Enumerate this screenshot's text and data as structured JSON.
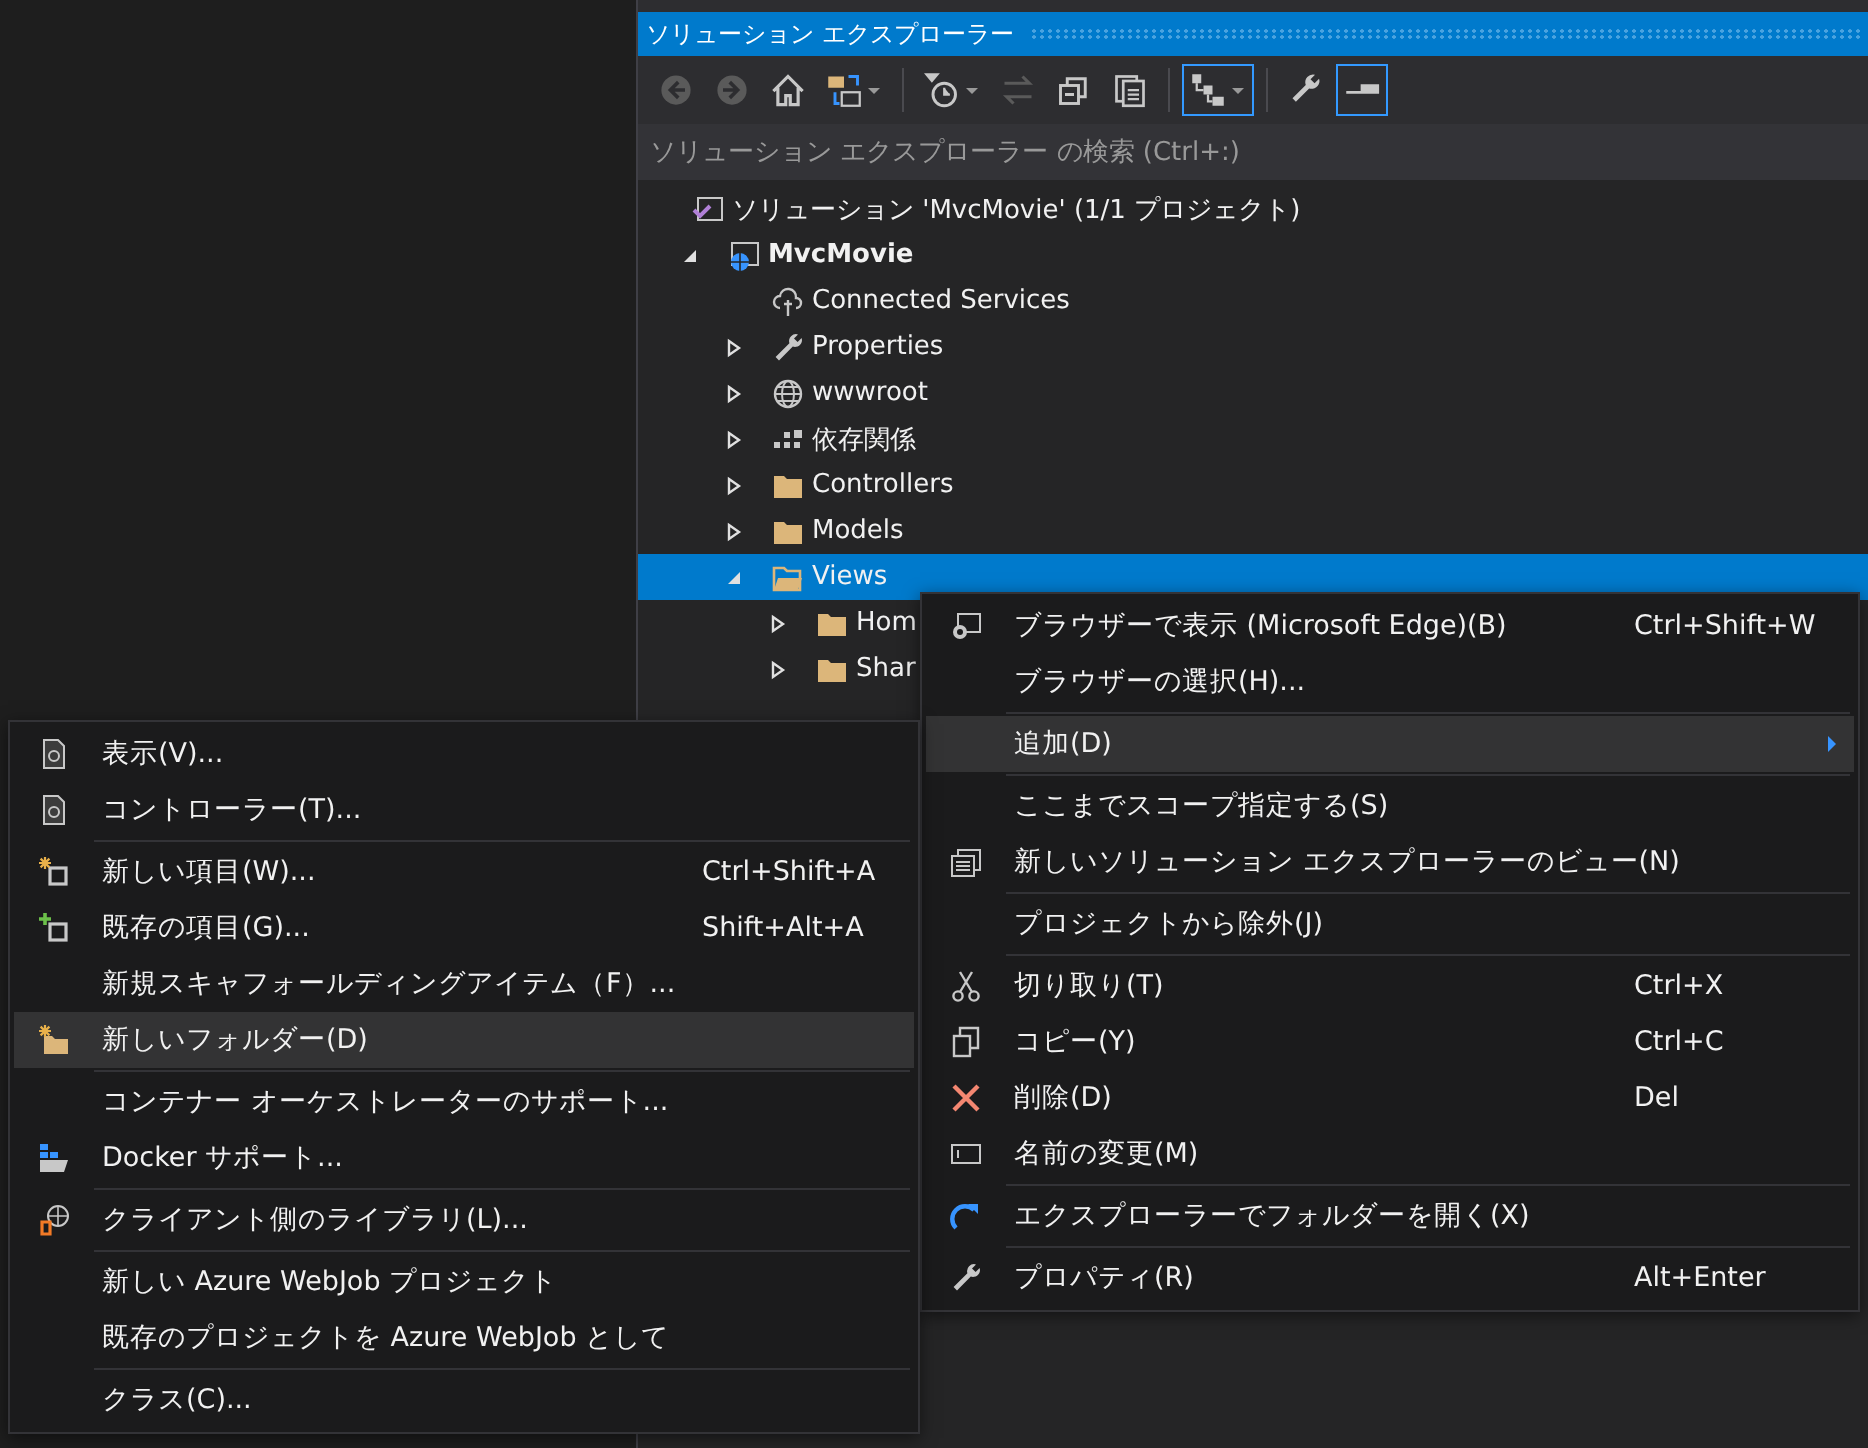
{
  "panel": {
    "title": "ソリューション エクスプローラー",
    "toolbar": [
      {
        "kind": "button",
        "selected": false,
        "disabled": true,
        "dropdown": false
      },
      {
        "kind": "button",
        "selected": false,
        "disabled": true,
        "dropdown": false
      },
      {
        "kind": "button",
        "selected": false,
        "disabled": false,
        "dropdown": false
      },
      {
        "kind": "button",
        "selected": false,
        "disabled": false,
        "dropdown": true
      },
      {
        "kind": "separator"
      },
      {
        "kind": "button",
        "selected": false,
        "disabled": false,
        "dropdown": true
      },
      {
        "kind": "button",
        "selected": false,
        "disabled": true,
        "dropdown": false
      },
      {
        "kind": "button",
        "selected": false,
        "disabled": false,
        "dropdown": false
      },
      {
        "kind": "button",
        "selected": false,
        "disabled": false,
        "dropdown": false
      },
      {
        "kind": "separator"
      },
      {
        "kind": "button",
        "selected": true,
        "disabled": false,
        "dropdown": true
      },
      {
        "kind": "separator"
      },
      {
        "kind": "button",
        "selected": false,
        "disabled": false,
        "dropdown": false
      },
      {
        "kind": "button",
        "selected": true,
        "disabled": false,
        "dropdown": false
      }
    ],
    "search": {
      "placeholder": "ソリューション エクスプローラー の検索 (Ctrl+:)"
    },
    "tree": [
      {
        "label": "ソリューション 'MvcMovie' (1/1 プロジェクト)",
        "kind": "solution",
        "selected": false,
        "children": [
          {
            "label": "MvcMovie",
            "kind": "project",
            "expanded": true,
            "selected": false,
            "children": [
              {
                "label": "Connected Services",
                "kind": "service",
                "selected": false
              },
              {
                "label": "Properties",
                "kind": "properties",
                "expanded": false,
                "selected": false
              },
              {
                "label": "wwwroot",
                "kind": "web",
                "expanded": false,
                "selected": false
              },
              {
                "label": "依存関係",
                "kind": "dependencies",
                "expanded": false,
                "selected": false
              },
              {
                "label": "Controllers",
                "kind": "folder",
                "expanded": false,
                "selected": false
              },
              {
                "label": "Models",
                "kind": "folder",
                "expanded": false,
                "selected": false
              },
              {
                "label": "Views",
                "kind": "folder",
                "expanded": true,
                "selected": true,
                "children": [
                  {
                    "label": "Hom",
                    "kind": "folder",
                    "expanded": false,
                    "selected": false
                  },
                  {
                    "label": "Shar",
                    "kind": "folder",
                    "expanded": false,
                    "selected": false
                  }
                ]
              }
            ]
          }
        ]
      }
    ]
  },
  "context_menu": [
    {
      "kind": "item",
      "label": "ブラウザーで表示 (Microsoft Edge)(B)",
      "shortcut": "Ctrl+Shift+W",
      "selected": false,
      "submenu": false
    },
    {
      "kind": "item",
      "label": "ブラウザーの選択(H)...",
      "selected": false,
      "submenu": false
    },
    {
      "kind": "separator"
    },
    {
      "kind": "item",
      "label": "追加(D)",
      "selected": true,
      "submenu": true
    },
    {
      "kind": "separator"
    },
    {
      "kind": "item",
      "label": "ここまでスコープ指定する(S)",
      "selected": false,
      "submenu": false
    },
    {
      "kind": "item",
      "label": "新しいソリューション エクスプローラーのビュー(N)",
      "selected": false,
      "submenu": false
    },
    {
      "kind": "separator"
    },
    {
      "kind": "item",
      "label": "プロジェクトから除外(J)",
      "selected": false,
      "submenu": false
    },
    {
      "kind": "separator"
    },
    {
      "kind": "item",
      "label": "切り取り(T)",
      "shortcut": "Ctrl+X",
      "selected": false,
      "submenu": false
    },
    {
      "kind": "item",
      "label": "コピー(Y)",
      "shortcut": "Ctrl+C",
      "selected": false,
      "submenu": false
    },
    {
      "kind": "item",
      "label": "削除(D)",
      "shortcut": "Del",
      "selected": false,
      "submenu": false
    },
    {
      "kind": "item",
      "label": "名前の変更(M)",
      "selected": false,
      "submenu": false
    },
    {
      "kind": "separator"
    },
    {
      "kind": "item",
      "label": "エクスプローラーでフォルダーを開く(X)",
      "selected": false,
      "submenu": false
    },
    {
      "kind": "separator"
    },
    {
      "kind": "item",
      "label": "プロパティ(R)",
      "shortcut": "Alt+Enter",
      "selected": false,
      "submenu": false
    }
  ],
  "add_submenu": [
    {
      "kind": "item",
      "label": "表示(V)...",
      "selected": false
    },
    {
      "kind": "item",
      "label": "コントローラー(T)...",
      "selected": false
    },
    {
      "kind": "separator"
    },
    {
      "kind": "item",
      "label": "新しい項目(W)...",
      "shortcut": "Ctrl+Shift+A",
      "selected": false
    },
    {
      "kind": "item",
      "label": "既存の項目(G)...",
      "shortcut": "Shift+Alt+A",
      "selected": false
    },
    {
      "kind": "item",
      "label": "新規スキャフォールディングアイテム（F）...",
      "selected": false
    },
    {
      "kind": "item",
      "label": "新しいフォルダー(D)",
      "selected": true
    },
    {
      "kind": "separator"
    },
    {
      "kind": "item",
      "label": "コンテナー オーケストレーターのサポート...",
      "selected": false
    },
    {
      "kind": "item",
      "label": "Docker サポート...",
      "selected": false
    },
    {
      "kind": "separator"
    },
    {
      "kind": "item",
      "label": "クライアント側のライブラリ(L)...",
      "selected": false
    },
    {
      "kind": "separator"
    },
    {
      "kind": "item",
      "label": "新しい Azure WebJob プロジェクト",
      "selected": false
    },
    {
      "kind": "item",
      "label": "既存のプロジェクトを Azure WebJob として",
      "selected": false
    },
    {
      "kind": "separator"
    },
    {
      "kind": "item",
      "label": "クラス(C)...",
      "selected": false
    }
  ]
}
